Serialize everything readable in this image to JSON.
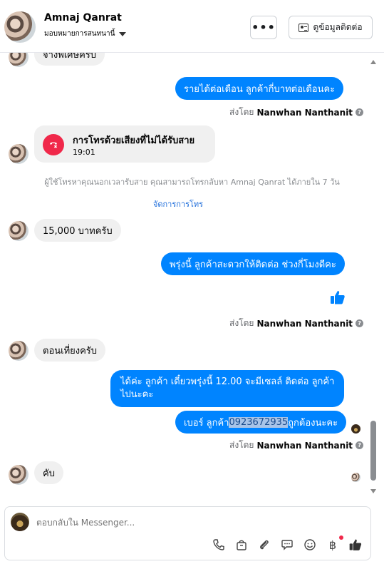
{
  "header": {
    "name": "Amnaj Qanrat",
    "assigned": "มอบหมายการสนทนานี้",
    "more_label": "•••",
    "contact_label": "ดูข้อมูลติดต่อ"
  },
  "messages": {
    "partial_top": "จ้างพิเศษครับ",
    "out1": "รายได้ต่อเดือน ลูกค้ากี่บาทต่อเดือนคะ",
    "sent_by_prefix": "ส่งโดย",
    "sender": "Nanwhan Nanthanit",
    "call_title": "การโทรด้วยเสียงที่ไม่ได้รับสาย",
    "call_time": "19:01",
    "call_notice": "ผู้ใช้โทรหาคุณนอกเวลารับสาย คุณสามารถโทรกลับหา Amnaj Qanrat ได้ภายใน 7 วัน",
    "manage_calls": "จัดการการโทร",
    "in1": "15,000 บาทครับ",
    "out2": "พรุ่งนี้ ลูกค้าสะดวกให้ติดต่อ ช่วงกี่โมงดีคะ",
    "in2": "ตอนเที่ยงครับ",
    "out3_line1": "ได้ค่ะ ลูกค้า เดี๋ยวพรุ่งนี้ 12.00 จะมีเซลล์ ติดต่อ ลูกค้า",
    "out3_line2": "ไปนะคะ",
    "out4_prefix": "เบอร์ ลูกค้า ",
    "out4_phone": "0923672935",
    "out4_suffix": " ถูกต้องนะคะ",
    "in3": "คับ"
  },
  "composer": {
    "placeholder": "ตอบกลับใน Messenger..."
  },
  "icons": [
    "phone-icon",
    "bag-icon",
    "paperclip-icon",
    "chat-bubble-icon",
    "emoji-icon",
    "baht-icon",
    "thumbs-up-icon"
  ]
}
